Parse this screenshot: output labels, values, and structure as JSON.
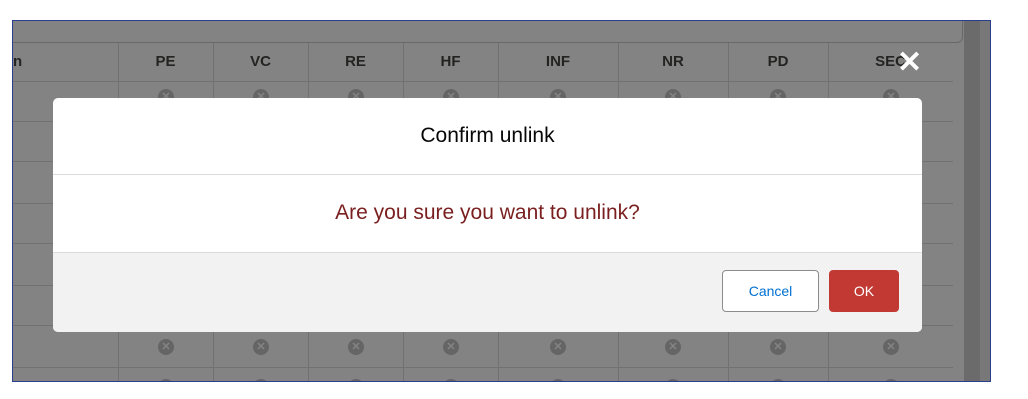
{
  "table": {
    "first_header_partial": "n",
    "headers": [
      "PE",
      "VC",
      "RE",
      "HF",
      "INF",
      "NR",
      "PD",
      "SEC"
    ]
  },
  "modal": {
    "title": "Confirm unlink",
    "message": "Are you sure you want to unlink?",
    "cancel_label": "Cancel",
    "ok_label": "OK",
    "close_glyph": "✕"
  },
  "icons": {
    "cell_status": "x-circle-icon",
    "close": "close-icon"
  },
  "colors": {
    "backdrop": "rgba(8,7,7,0.5)",
    "message_text": "#7a1f1f",
    "ok_button": "#c23934",
    "cancel_text": "#0070d2",
    "frame_border": "#2a3d8f"
  }
}
